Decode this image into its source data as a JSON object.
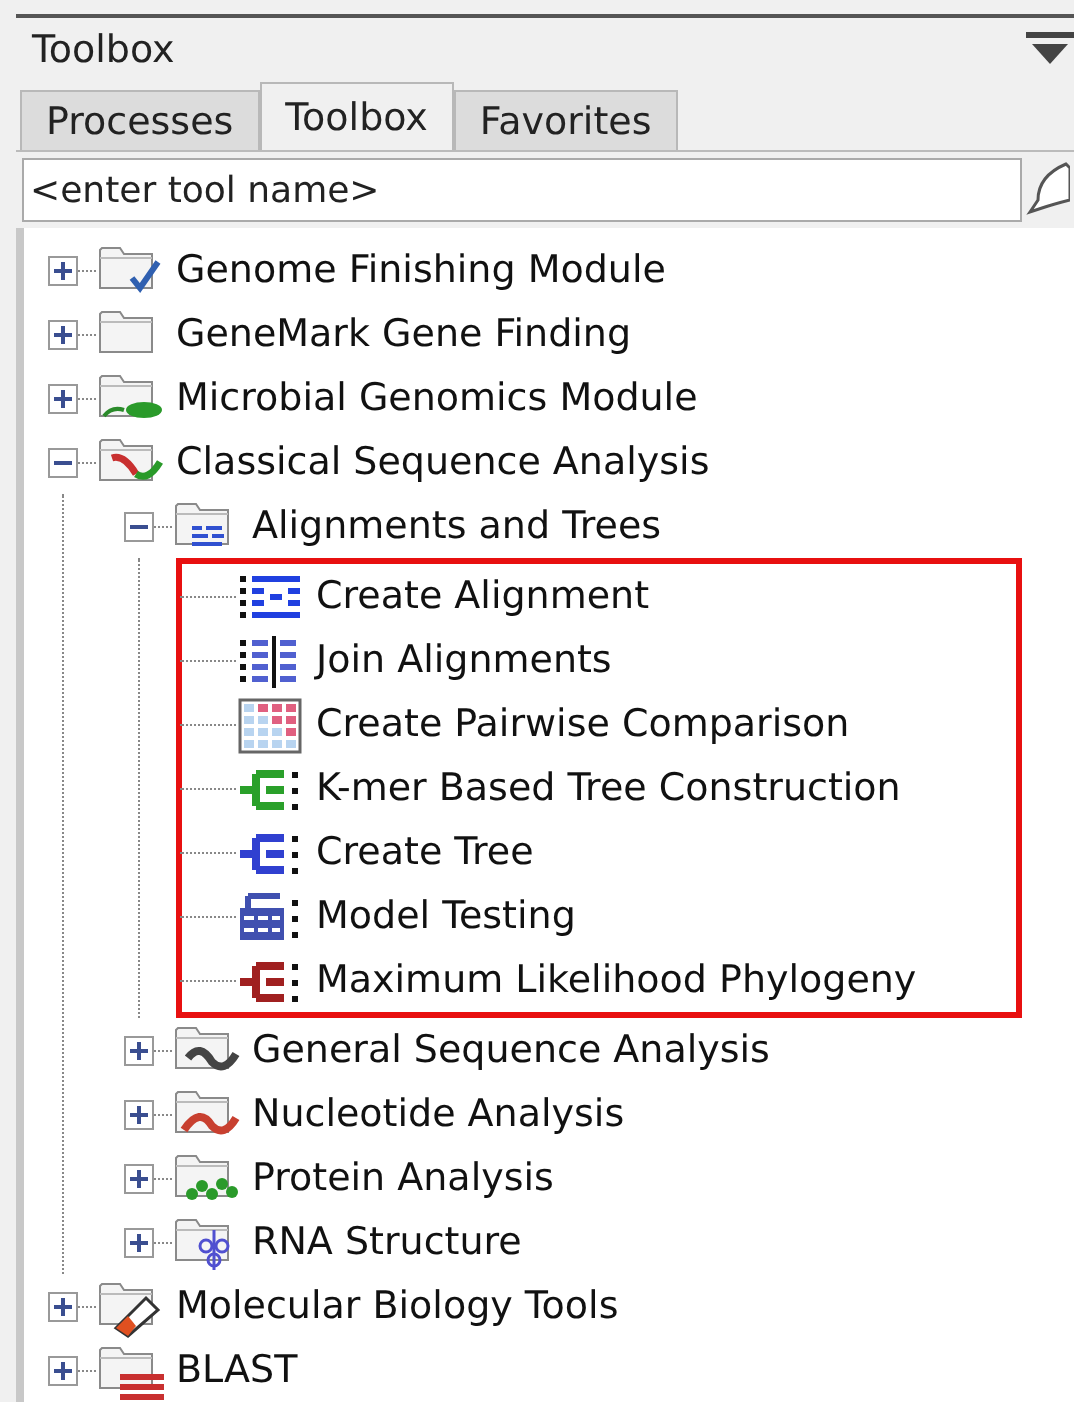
{
  "panel": {
    "title": "Toolbox"
  },
  "tabs": [
    {
      "label": "Processes",
      "selected": false
    },
    {
      "label": "Toolbox",
      "selected": true
    },
    {
      "label": "Favorites",
      "selected": false
    }
  ],
  "search": {
    "placeholder": "<enter tool name>"
  },
  "tree": [
    {
      "label": "Genome Finishing Module",
      "kind": "folder-check",
      "expanded": false
    },
    {
      "label": "GeneMark Gene Finding",
      "kind": "folder",
      "expanded": false
    },
    {
      "label": "Microbial Genomics Module",
      "kind": "folder-bug",
      "expanded": false
    },
    {
      "label": "Classical Sequence Analysis",
      "kind": "folder-wave-mixed",
      "expanded": true,
      "children": [
        {
          "label": "Alignments and Trees",
          "kind": "folder-alignment",
          "expanded": true,
          "highlighted": true,
          "children": [
            {
              "label": "Create Alignment",
              "kind": "alignment"
            },
            {
              "label": "Join Alignments",
              "kind": "join-alignment"
            },
            {
              "label": "Create Pairwise Comparison",
              "kind": "grid"
            },
            {
              "label": "K-mer Based Tree Construction",
              "kind": "tree-green"
            },
            {
              "label": "Create Tree",
              "kind": "tree-blue"
            },
            {
              "label": "Model Testing",
              "kind": "tree-table"
            },
            {
              "label": "Maximum Likelihood Phylogeny",
              "kind": "tree-red"
            }
          ]
        },
        {
          "label": "General Sequence Analysis",
          "kind": "folder-wave-gray",
          "expanded": false
        },
        {
          "label": "Nucleotide Analysis",
          "kind": "folder-wave-red",
          "expanded": false
        },
        {
          "label": "Protein Analysis",
          "kind": "folder-wave-green",
          "expanded": false
        },
        {
          "label": "RNA Structure",
          "kind": "folder-rna",
          "expanded": false
        }
      ]
    },
    {
      "label": "Molecular Biology Tools",
      "kind": "folder-pen",
      "expanded": false
    },
    {
      "label": "BLAST",
      "kind": "folder-bars",
      "expanded": false
    }
  ]
}
